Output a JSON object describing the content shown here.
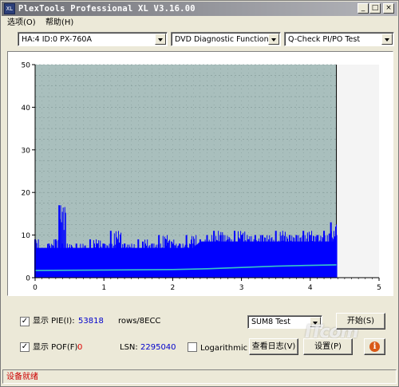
{
  "window": {
    "title": "PlexTools Professional XL V3.16.00",
    "icon_text": "XL",
    "controls": [
      "minimize-icon",
      "maximize-icon",
      "close-icon"
    ]
  },
  "menu": {
    "items": [
      "选项(O)",
      "帮助(H)"
    ]
  },
  "toolbar": {
    "drive": "HA:4 ID:0  PX-760A",
    "function": "DVD Diagnostic Functions",
    "test": "Q-Check PI/PO Test"
  },
  "chart_data": {
    "type": "bar",
    "description_visible": false,
    "xlim": [
      0,
      5
    ],
    "ylim": [
      0,
      50
    ],
    "x_ticks": [
      0,
      1,
      2,
      3,
      4,
      5
    ],
    "y_ticks": [
      0,
      10,
      20,
      30,
      40,
      50
    ],
    "disc_end_x": 4.38,
    "background_color": "#a9bfbd",
    "plot_fill_color": "#0000ff",
    "line_color": "#37c6c6",
    "series": [
      {
        "kind": "bars",
        "x": [
          0.0,
          0.1,
          0.2,
          0.3,
          0.35,
          0.4,
          0.5,
          0.6,
          0.7,
          0.8,
          0.9,
          1.0,
          1.1,
          1.2,
          1.3,
          1.4,
          1.5,
          1.6,
          1.7,
          1.8,
          1.9,
          2.0,
          2.1,
          2.2,
          2.3,
          2.4,
          2.5,
          2.6,
          2.7,
          2.8,
          2.9,
          3.0,
          3.1,
          3.2,
          3.3,
          3.4,
          3.5,
          3.6,
          3.7,
          3.8,
          3.9,
          4.0,
          4.1,
          4.2,
          4.3,
          4.38
        ],
        "y": [
          9,
          7,
          8,
          9,
          17,
          8,
          7,
          8,
          7,
          9,
          8,
          8,
          11,
          8,
          8,
          7,
          9,
          8,
          8,
          10,
          9,
          8,
          8,
          10,
          8,
          9,
          10,
          11,
          10,
          9,
          11,
          10,
          9,
          10,
          10,
          9,
          11,
          10,
          10,
          10,
          11,
          10,
          10,
          11,
          13,
          10
        ]
      },
      {
        "kind": "line",
        "x": [
          0.0,
          1.0,
          2.0,
          2.5,
          3.0,
          3.5,
          4.0,
          4.38
        ],
        "y": [
          1.7,
          1.8,
          1.9,
          2.1,
          2.4,
          2.7,
          2.9,
          3.0
        ]
      }
    ]
  },
  "controls": {
    "pie_checkbox": "✓",
    "pie_label": "显示 PIE(I):",
    "pie_value": "53818",
    "pie_unit": "rows/8ECC",
    "pof_checkbox": "✓",
    "pof_label": "显示 POF(F)",
    "pof_value": "0",
    "lsn_label": "LSN:",
    "lsn_value": "2295040",
    "log_label": "Logarithmic",
    "sum_combo": "SUM8 Test",
    "start_button": "开始(S)",
    "log_button": "查看日志(V)",
    "settings_button": "设置(P)",
    "info_button": "i",
    "watermark": "ITcom"
  },
  "status": {
    "text": "设备就绪"
  }
}
